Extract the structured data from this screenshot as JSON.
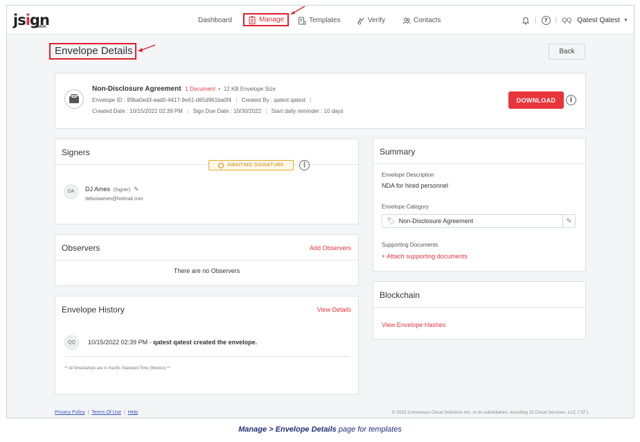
{
  "app": {
    "logo": "jsign",
    "logo_sub": "admin"
  },
  "nav": {
    "dashboard": "Dashboard",
    "manage": "Manage",
    "templates": "Templates",
    "verify": "Verify",
    "contacts": "Contacts"
  },
  "user": {
    "initials": "QQ",
    "name": "Qatest Qatest"
  },
  "page": {
    "title": "Envelope Details",
    "back_label": "Back"
  },
  "envelope": {
    "name": "Non-Disclosure Agreement",
    "documents": "1 Document",
    "separator": "•",
    "size": "12 KB Envelope Size",
    "id": "Envelope ID : 99ba0ed3-aad0-4417-9e61-d65d961ba0f4",
    "created_by": "Created By : qatest qatest",
    "created_date": "Created Date : 10/15/2022 02:39 PM",
    "due_date": "Sign Due Date : 10/30/2022",
    "reminder": "Start daily reminder : 10 days",
    "download_label": "DOWNLOAD"
  },
  "signers": {
    "heading": "Signers",
    "items": [
      {
        "initials": "DA",
        "name": "DJ Ames",
        "role": "(Signer)",
        "email": "deboraames@hotmail.com",
        "status": "AWAITING SIGNATURE"
      }
    ]
  },
  "observers": {
    "heading": "Observers",
    "action": "Add Observers",
    "empty": "There are no Observers"
  },
  "history": {
    "heading": "Envelope History",
    "action": "View Details",
    "entries": [
      {
        "initials": "QQ",
        "timestamp": "10/15/2022 02:39 PM",
        "dash": "-",
        "text": "qatest qatest created the envelope."
      }
    ],
    "note": "** All timestamps are in Pacific Standard Time (Mexico) **"
  },
  "summary": {
    "heading": "Summary",
    "description_label": "Envelope Description",
    "description_value": "NDA for hired personnel",
    "category_label": "Envelope Category",
    "category_value": "Non-Disclosure Agreement",
    "supporting_label": "Supporting Documents",
    "supporting_action": "+ Attach supporting documents"
  },
  "blockchain": {
    "heading": "Blockchain",
    "action": "View Envelope Hashes"
  },
  "footer": {
    "privacy": "Privacy Policy",
    "terms": "Terms Of Use",
    "help": "Help",
    "copyright": "© 2022 Consensus Cloud Solutions Inc. or its subsidiaries, including J2 Cloud Services, LLC (\"J2\")."
  },
  "caption": {
    "bold": "Manage > Envelope Details",
    "rest": " page for templates"
  },
  "colors": {
    "accent": "#e0343f",
    "highlight_box": "#e01f2a",
    "badge": "#e6a82c",
    "caption": "#1f2f7a"
  }
}
